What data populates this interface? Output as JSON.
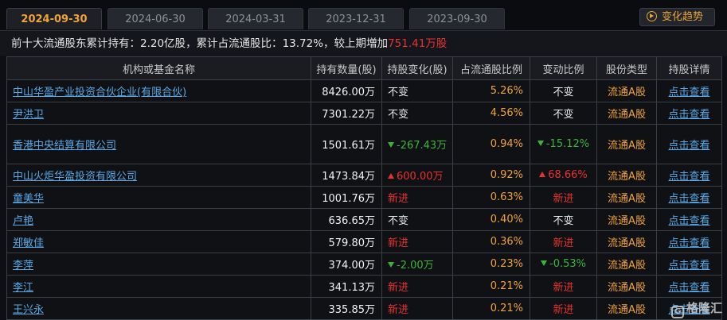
{
  "tabs": [
    {
      "label": "2024-09-30",
      "active": true
    },
    {
      "label": "2024-06-30",
      "active": false
    },
    {
      "label": "2024-03-31",
      "active": false
    },
    {
      "label": "2023-12-31",
      "active": false
    },
    {
      "label": "2023-09-30",
      "active": false
    }
  ],
  "trend_button": {
    "label": "变化趋势",
    "icon": "play-circle-icon"
  },
  "summary": {
    "prefix": "前十大流通股东累计持有：",
    "total": "2.20亿股",
    "ratio_prefix": "，累计占流通股比：",
    "ratio": "13.72%",
    "change_prefix": "，较上期増加",
    "change": "751.41万股"
  },
  "table": {
    "headers": [
      "机构或基金名称",
      "持有数量(股)",
      "持股变化(股)",
      "占流通股比例",
      "变动比例",
      "股份类型",
      "持股详情"
    ],
    "rows": [
      {
        "name": "中山华盈产业投资合伙企业(有限合伙)",
        "qty": "8426.00万",
        "change": "不变",
        "ratio": "5.26%",
        "change_ratio": "不变",
        "type": "流通A股",
        "detail": "点击查看"
      },
      {
        "name": "尹洪卫",
        "qty": "7301.22万",
        "change": "不变",
        "ratio": "4.56%",
        "change_ratio": "不变",
        "type": "流通A股",
        "detail": "点击查看"
      },
      {
        "name": "香港中央结算有限公司",
        "qty": "1501.61万",
        "change": "-267.43万",
        "ratio": "0.94%",
        "change_ratio": "-15.12%",
        "type": "流通A股",
        "detail": "点击查看"
      },
      {
        "name": "中山火炬华盈投资有限公司",
        "qty": "1473.84万",
        "change": "600.00万",
        "ratio": "0.92%",
        "change_ratio": "68.66%",
        "type": "流通A股",
        "detail": "点击查看"
      },
      {
        "name": "童美华",
        "qty": "1001.76万",
        "change": "新进",
        "ratio": "0.63%",
        "change_ratio": "新进",
        "type": "流通A股",
        "detail": "点击查看"
      },
      {
        "name": "卢艳",
        "qty": "636.65万",
        "change": "不变",
        "ratio": "0.40%",
        "change_ratio": "不变",
        "type": "流通A股",
        "detail": "点击查看"
      },
      {
        "name": "郑敏佳",
        "qty": "579.80万",
        "change": "新进",
        "ratio": "0.36%",
        "change_ratio": "新进",
        "type": "流通A股",
        "detail": "点击查看"
      },
      {
        "name": "李萍",
        "qty": "374.00万",
        "change": "-2.00万",
        "ratio": "0.23%",
        "change_ratio": "-0.53%",
        "type": "流通A股",
        "detail": "点击查看"
      },
      {
        "name": "李江",
        "qty": "341.13万",
        "change": "新进",
        "ratio": "0.21%",
        "change_ratio": "新进",
        "type": "流通A股",
        "detail": "点击查看"
      },
      {
        "name": "王兴永",
        "qty": "335.85万",
        "change": "新进",
        "ratio": "0.21%",
        "change_ratio": "新进",
        "type": "流通A股",
        "detail": "点击查看"
      }
    ]
  },
  "watermark": "格隆汇",
  "colors": {
    "accent": "#f0a33a",
    "link": "#5aa9e6",
    "up": "#e8322f",
    "down": "#3cb43c",
    "background": "#0d0f14"
  }
}
